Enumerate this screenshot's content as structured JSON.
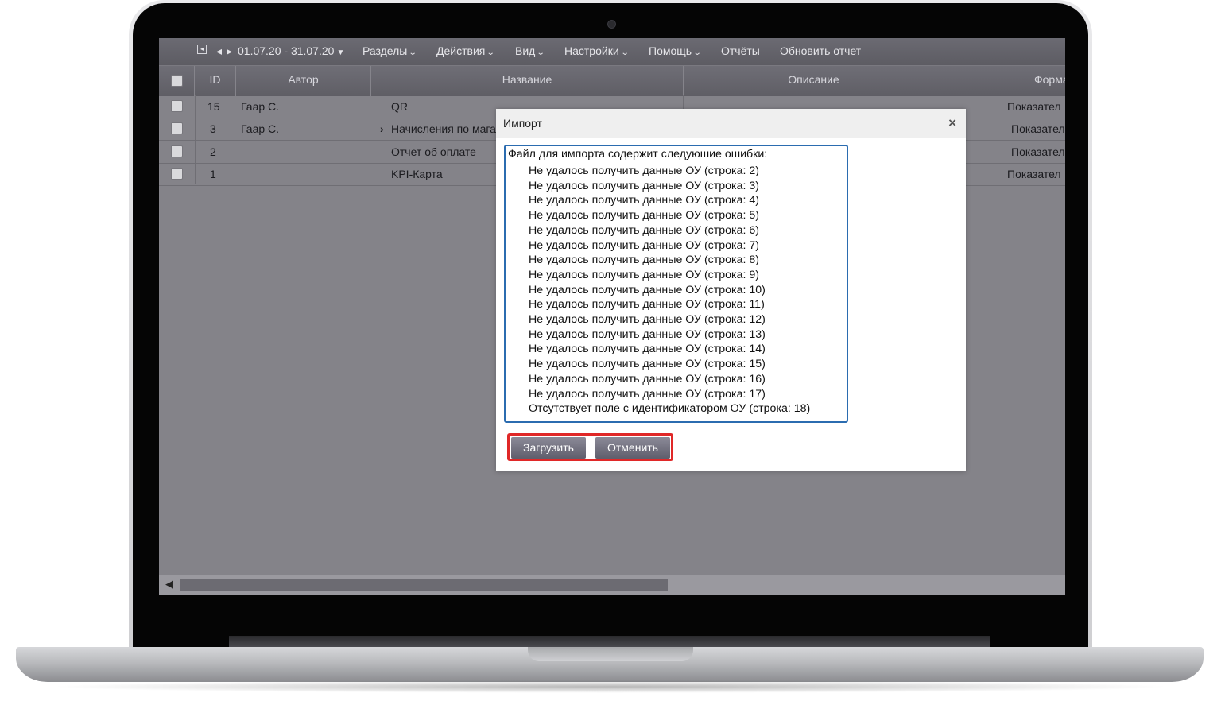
{
  "toolbar": {
    "date_range": "01.07.20 - 31.07.20",
    "menus": [
      "Разделы",
      "Действия",
      "Вид",
      "Настройки",
      "Помощь"
    ],
    "reports": "Отчёты",
    "refresh": "Обновить отчет"
  },
  "table": {
    "columns": [
      "ID",
      "Автор",
      "Название",
      "Описание",
      "Форма"
    ],
    "rows": [
      {
        "id": "15",
        "author": "Гаар С.",
        "name": "QR",
        "form": "Показател"
      },
      {
        "id": "3",
        "author": "Гаар С.",
        "name": "Начисления по мага",
        "form": "Показател"
      },
      {
        "id": "2",
        "author": "",
        "name": "Отчет об оплате",
        "form": "Показател"
      },
      {
        "id": "1",
        "author": "",
        "name": "KPI-Карта",
        "form": "Показател"
      }
    ]
  },
  "modal": {
    "title": "Импорт",
    "close": "×",
    "errors_title": "Файл для импорта содержит следуюшие ошибки:",
    "errors": [
      "Не удалось получить данные ОУ (строка: 2)",
      "Не удалось получить данные ОУ (строка: 3)",
      "Не удалось получить данные ОУ (строка: 4)",
      "Не удалось получить данные ОУ (строка: 5)",
      "Не удалось получить данные ОУ (строка: 6)",
      "Не удалось получить данные ОУ (строка: 7)",
      "Не удалось получить данные ОУ (строка: 8)",
      "Не удалось получить данные ОУ (строка: 9)",
      "Не удалось получить данные ОУ (строка: 10)",
      "Не удалось получить данные ОУ (строка: 11)",
      "Не удалось получить данные ОУ (строка: 12)",
      "Не удалось получить данные ОУ (строка: 13)",
      "Не удалось получить данные ОУ (строка: 14)",
      "Не удалось получить данные ОУ (строка: 15)",
      "Не удалось получить данные ОУ (строка: 16)",
      "Не удалось получить данные ОУ (строка: 17)",
      "Отсутствует поле с идентификатором ОУ (строка: 18)"
    ],
    "upload_button": "Загрузить",
    "cancel_button": "Отменить"
  },
  "icons": {
    "chevron": "▾",
    "expand": "›"
  },
  "colors": {
    "toolbar": "#5d5c63",
    "grid_background": "#848389",
    "error_box_border": "#2b6cb0",
    "button_highlight": "#e02828"
  }
}
